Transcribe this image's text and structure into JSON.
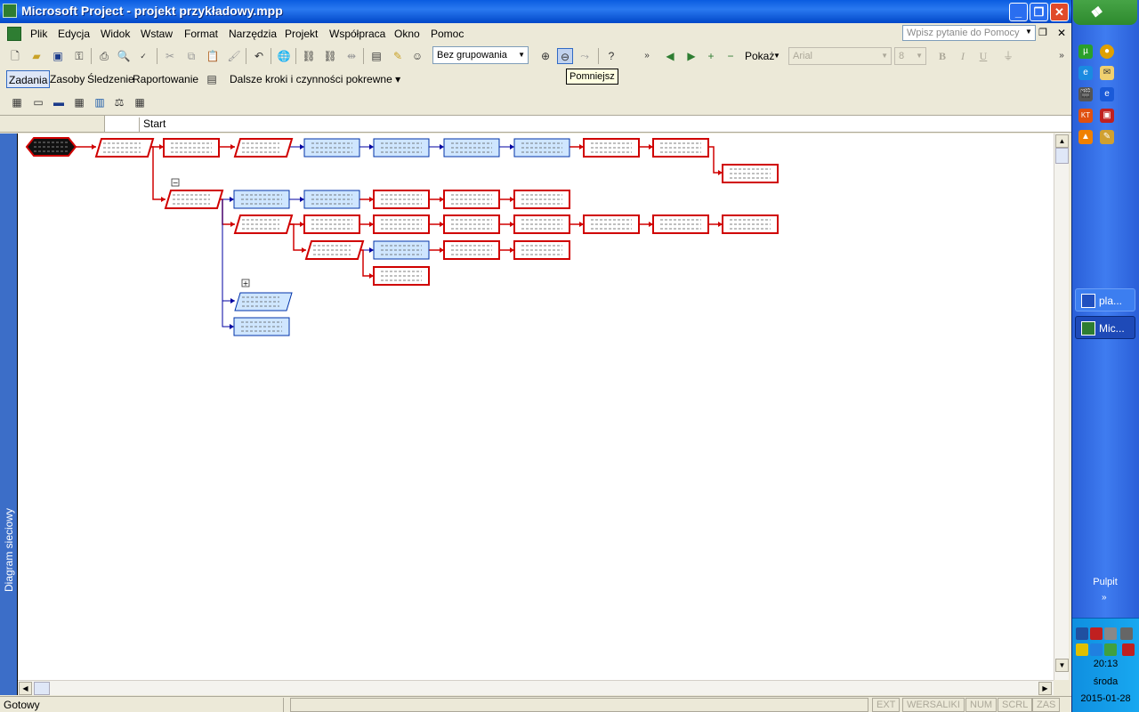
{
  "window": {
    "title": "Microsoft Project - projekt przykładowy.mpp",
    "buttons": {
      "minimize": "_",
      "restore": "❐",
      "close": "✕"
    }
  },
  "menu": [
    "Plik",
    "Edycja",
    "Widok",
    "Wstaw",
    "Format",
    "Narzędzia",
    "Projekt",
    "Współpraca",
    "Okno",
    "Pomoc"
  ],
  "help_search": {
    "placeholder": "Wpisz pytanie do Pomocy"
  },
  "toolbar": {
    "grouping": "Bez grupowania",
    "show_label": "Pokaż",
    "font": "Arial",
    "font_size": "8",
    "bold": "B",
    "italic": "I",
    "underline": "U"
  },
  "tooltip": "Pomniejsz",
  "guide_bar": {
    "tabs": [
      "Zadania",
      "Zasoby",
      "Śledzenie",
      "Raportowanie"
    ],
    "active_tab": "Zadania",
    "next_steps": "Dalsze kroki i czynności pokrewne"
  },
  "entry_bar": {
    "value": "Start"
  },
  "view_bar": {
    "label": "Diagram sieciowy"
  },
  "status_bar": {
    "ready": "Gotowy",
    "indicators": [
      "EXT",
      "WERSALIKI",
      "NUM",
      "SCRL",
      "ZAS"
    ]
  },
  "colors": {
    "critical": "#d00000",
    "noncritical_fill": "#cfe6ff",
    "noncritical_border": "#0033aa",
    "link_red": "#d00000",
    "link_blue": "#0000a0"
  },
  "taskbar": {
    "tasks": [
      {
        "label": "pla...",
        "icon": "word-icon"
      },
      {
        "label": "Mic...",
        "icon": "project-icon"
      }
    ],
    "desktop": "Pulpit",
    "clock": {
      "time": "20:13",
      "day": "środa",
      "date": "2015-01-28"
    }
  }
}
